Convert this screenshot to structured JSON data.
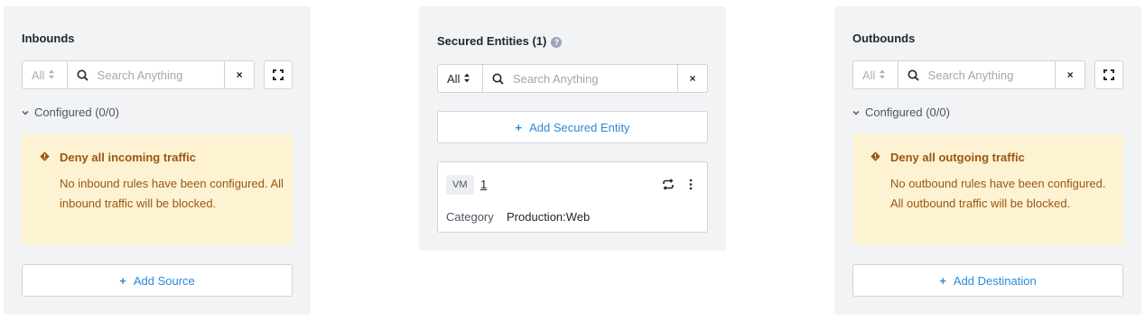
{
  "inbounds": {
    "title": "Inbounds",
    "filter_value": "All",
    "search_placeholder": "Search Anything",
    "clear_label": "×",
    "configured_label": "Configured (0/0)",
    "warning": {
      "title": "Deny all incoming traffic",
      "body": "No inbound rules have been configured. All inbound traffic will be blocked."
    },
    "add_label": "Add Source"
  },
  "entities": {
    "title": "Secured Entities (1)",
    "help_label": "?",
    "filter_value": "All",
    "search_placeholder": "Search Anything",
    "clear_label": "×",
    "add_label": "Add Secured Entity",
    "card": {
      "type_badge": "VM",
      "count_link": "1",
      "category_label": "Category",
      "category_value": "Production:Web"
    }
  },
  "outbounds": {
    "title": "Outbounds",
    "filter_value": "All",
    "search_placeholder": "Search Anything",
    "clear_label": "×",
    "configured_label": "Configured (0/0)",
    "warning": {
      "title": "Deny all outgoing traffic",
      "body": "No outbound rules have been configured. All outbound traffic will be blocked."
    },
    "add_label": "Add Destination"
  },
  "glyphs": {
    "plus": "+",
    "chevron": "⌄",
    "sort_arrows": "⬍"
  },
  "colors": {
    "panel_bg": "#f2f3f5",
    "warning_bg": "#fdf2d2",
    "warning_text": "#9b5712",
    "link_blue": "#2a8ad9"
  }
}
